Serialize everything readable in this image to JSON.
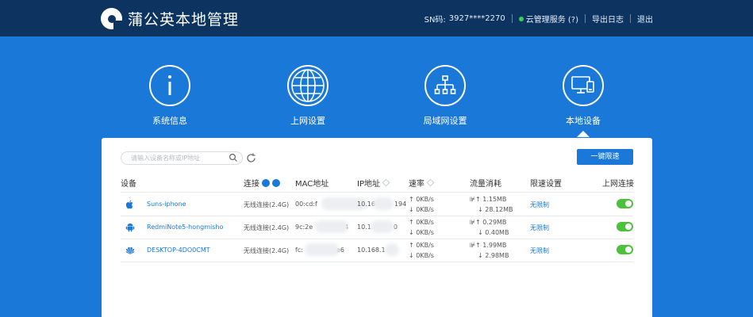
{
  "header": {
    "title": "蒲公英本地管理",
    "sn_label": "SN码:",
    "sn_value": "3927****2270",
    "cloud_service": "云管理服务 (?)",
    "export_log": "导出日志",
    "logout": "退出",
    "status_color": "#37d15a"
  },
  "nav": {
    "items": [
      {
        "label": "系统信息",
        "icon": "info-icon"
      },
      {
        "label": "上网设置",
        "icon": "globe-icon"
      },
      {
        "label": "局域网设置",
        "icon": "network-tree-icon"
      },
      {
        "label": "本地设备",
        "icon": "monitor-icon"
      }
    ],
    "active": "本地设备"
  },
  "toolbar": {
    "search_placeholder": "请输入设备名称或IP地址",
    "kick_button": "一键限速"
  },
  "table": {
    "columns": [
      "设备",
      "连接",
      "MAC地址",
      "IP地址",
      "速率",
      "流量消耗",
      "限速设置",
      "上网连接"
    ],
    "rows": [
      {
        "icon": "apple-icon",
        "name": "Suns-iphone",
        "connection": "无线连接(2.4G)",
        "mac_start": "00:cd:f",
        "mac_end": "",
        "ip_start": "10.16",
        "ip_end": "194",
        "up_speed": "↑ 0KB/s",
        "down_speed": "↓ 0KB/s",
        "up_flow": "↑ 1.15MB",
        "down_flow": "↓ 28.12MB",
        "limit": "无限制",
        "online": true
      },
      {
        "icon": "android-icon",
        "name": "RedmiNote5-hongmisho",
        "connection": "无线连接(2.4G)",
        "mac_start": "9c:2e",
        "mac_end": "4",
        "ip_start": "10.1",
        "ip_end": "0",
        "up_speed": "↑ 0KB/s",
        "down_speed": "↓ 0KB/s",
        "up_flow": "↑ 0.29MB",
        "down_flow": "↓ 0.40MB",
        "limit": "无限制",
        "online": true
      },
      {
        "icon": "huawei-icon",
        "name": "DESKTOP-4DO0CMT",
        "connection": "无线连接(2.4G)",
        "mac_start": "fc:",
        "mac_end": "e6",
        "ip_start": "10.168.1",
        "ip_end": "",
        "up_speed": "↑ 0KB/s",
        "down_speed": "↓ 0KB/s",
        "up_flow": "↑ 1.99MB",
        "down_flow": "↓ 2.98MB",
        "limit": "无限制",
        "online": true
      }
    ]
  },
  "colors": {
    "accent": "#1a78d8",
    "header": "#0d3461",
    "toggle_on": "#4cc13b"
  }
}
